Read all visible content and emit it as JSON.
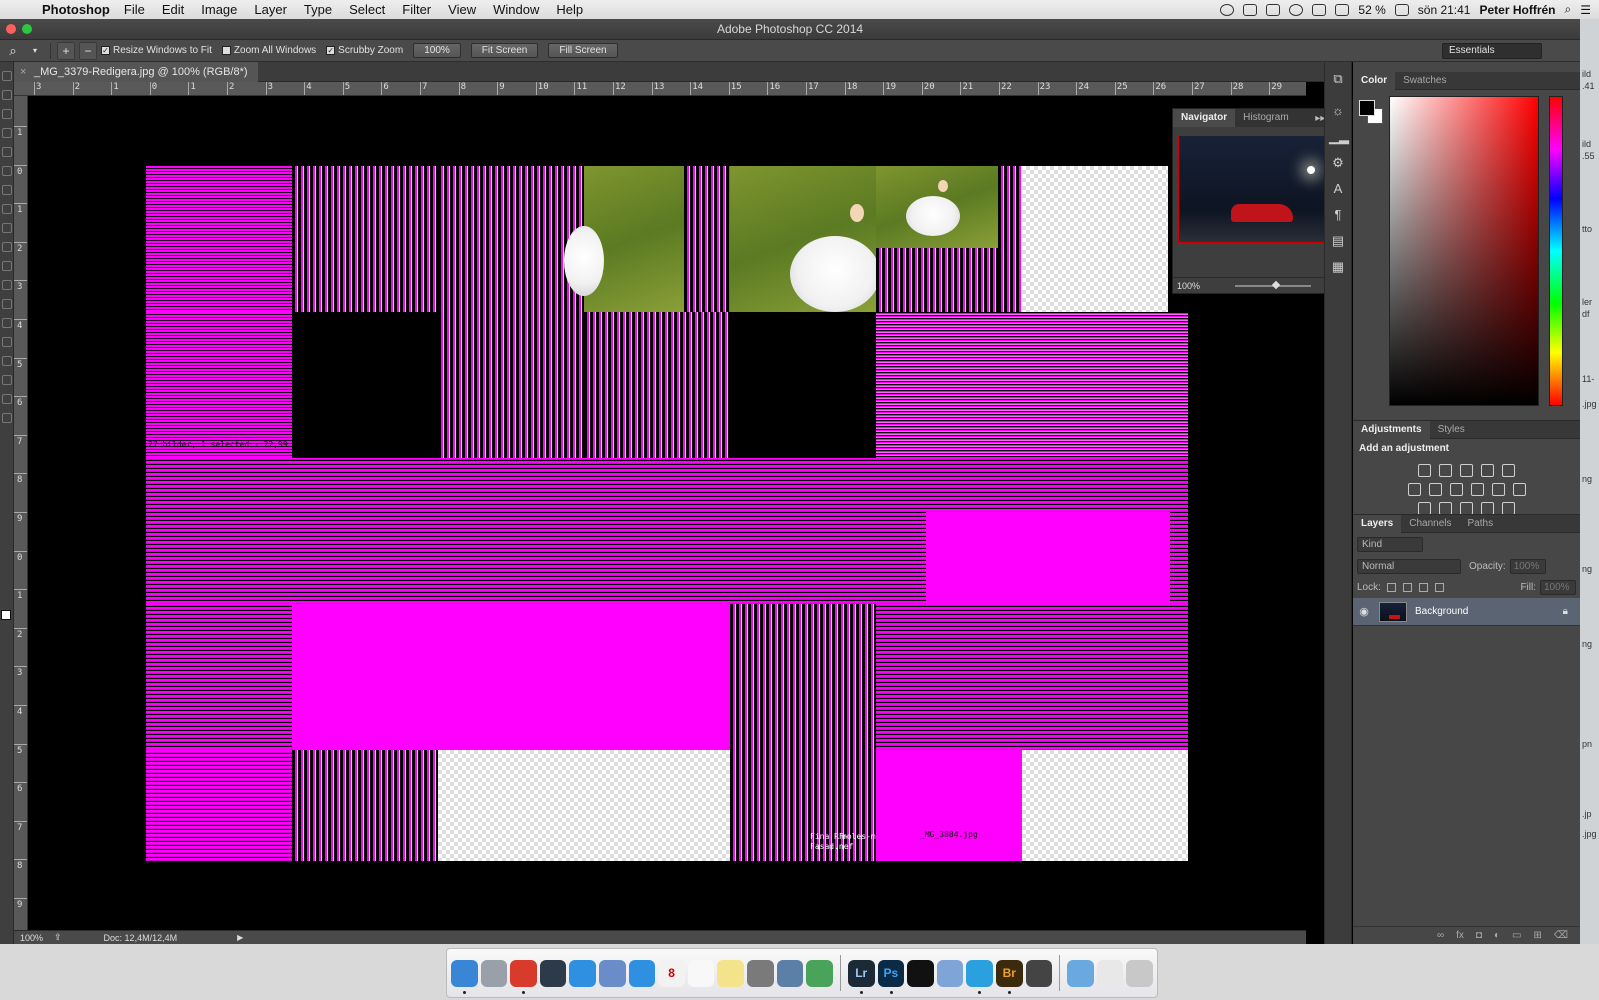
{
  "menubar": {
    "apple": "",
    "app_name": "Photoshop",
    "items": [
      "File",
      "Edit",
      "Image",
      "Layer",
      "Type",
      "Select",
      "Filter",
      "View",
      "Window",
      "Help"
    ],
    "battery": "52 %",
    "clock": "sön 21:41",
    "user": "Peter Hoffrén"
  },
  "window": {
    "title": "Adobe Photoshop CC 2014"
  },
  "options_bar": {
    "resize_windows_label": "Resize Windows to Fit",
    "zoom_all_label": "Zoom All Windows",
    "scrubby_zoom_label": "Scrubby Zoom",
    "zoom_100": "100%",
    "fit_screen": "Fit Screen",
    "fill_screen": "Fill Screen",
    "workspace": "Essentials"
  },
  "document": {
    "tab_title": "_MG_3379-Redigera.jpg @ 100% (RGB/8*)",
    "close": "×"
  },
  "rulers": {
    "top_labels": [
      "3",
      "2",
      "1",
      "0",
      "1",
      "2",
      "3",
      "4",
      "5",
      "6",
      "7",
      "8",
      "9",
      "10",
      "11",
      "12",
      "13",
      "14",
      "15",
      "16",
      "17",
      "18",
      "19",
      "20",
      "21",
      "22",
      "23",
      "24",
      "25",
      "26",
      "27",
      "28",
      "29"
    ],
    "left_labels": [
      "1",
      "0",
      "1",
      "2",
      "3",
      "4",
      "5",
      "6",
      "7",
      "8",
      "9",
      "0",
      "1",
      "2",
      "3",
      "4",
      "5",
      "6",
      "7",
      "8",
      "9"
    ]
  },
  "canvas_text": {
    "bridge_status": "27 bilder, 1 selected - 22,99 MB",
    "filename_1": "_MG_3884.jpg",
    "folder_1": "Fasad.nef",
    "folder_2": "Fina RF-",
    "folder_3": "moles-mall"
  },
  "navigator": {
    "tabs": [
      "Navigator",
      "Histogram"
    ],
    "zoom": "100%"
  },
  "color_panel": {
    "tabs": [
      "Color",
      "Swatches"
    ],
    "fg_color": "#000000",
    "bg_color": "#ffffff"
  },
  "adjustments_panel": {
    "tabs": [
      "Adjustments",
      "Styles"
    ],
    "heading": "Add an adjustment",
    "icons_row1": [
      "brightness-contrast-icon",
      "levels-icon",
      "curves-icon",
      "exposure-icon",
      "vibrance-icon"
    ],
    "icons_row2": [
      "hue-saturation-icon",
      "color-balance-icon",
      "black-white-icon",
      "photo-filter-icon",
      "channel-mixer-icon",
      "color-lookup-icon"
    ],
    "icons_row3": [
      "invert-icon",
      "posterize-icon",
      "threshold-icon",
      "selective-color-icon",
      "gradient-map-icon"
    ]
  },
  "layers_panel": {
    "tabs": [
      "Layers",
      "Channels",
      "Paths"
    ],
    "filter_kind": "Kind",
    "blend_mode": "Normal",
    "opacity_label": "Opacity:",
    "opacity_value": "100%",
    "lock_label": "Lock:",
    "fill_label": "Fill:",
    "fill_value": "100%",
    "layers": [
      {
        "name": "Background",
        "visible": true,
        "locked": true
      }
    ]
  },
  "status_bar": {
    "zoom": "100%",
    "doc_info": "Doc: 12,4M/12,4M"
  },
  "right_edge_text": [
    "ild",
    ".41",
    "ild",
    ".55",
    "tto",
    "ler",
    "df",
    "11-",
    ".jpg",
    "ng",
    "ng",
    "ng",
    "pn",
    ".jp",
    ".jpg"
  ],
  "dock": {
    "apps": [
      {
        "name": "finder-icon",
        "label": "",
        "color": "#3a86d6",
        "running": true
      },
      {
        "name": "launchpad-icon",
        "label": "",
        "color": "#9aa0aa",
        "running": false
      },
      {
        "name": "chrome-icon",
        "label": "",
        "color": "#d83b2b",
        "running": true
      },
      {
        "name": "mission-control-icon",
        "label": "",
        "color": "#2d3a4a",
        "running": false
      },
      {
        "name": "app-store-icon",
        "label": "",
        "color": "#2f8fe0",
        "running": false
      },
      {
        "name": "mail-send-icon",
        "label": "",
        "color": "#6a8cc8",
        "running": false
      },
      {
        "name": "safari-icon",
        "label": "",
        "color": "#2f8fe0",
        "running": false
      },
      {
        "name": "calendar-icon",
        "label": "8",
        "color": "#f2f2f2",
        "running": false
      },
      {
        "name": "reminders-icon",
        "label": "",
        "color": "#f8f8f8",
        "running": false
      },
      {
        "name": "notes-icon",
        "label": "",
        "color": "#f3e38a",
        "running": false
      },
      {
        "name": "system-preferences-icon",
        "label": "",
        "color": "#7a7a7a",
        "running": false
      },
      {
        "name": "preview-icon",
        "label": "",
        "color": "#5c7fa8",
        "running": false
      },
      {
        "name": "spotify-icon",
        "label": "",
        "color": "#4aa35a",
        "running": false
      },
      {
        "name": "lightroom-icon",
        "label": "Lr",
        "color": "#1c2a38",
        "running": true
      },
      {
        "name": "photoshop-icon",
        "label": "Ps",
        "color": "#0b2a45",
        "running": true
      },
      {
        "name": "terminal-icon",
        "label": "",
        "color": "#111111",
        "running": false
      },
      {
        "name": "mail-icon",
        "label": "",
        "color": "#7fa4d8",
        "running": false
      },
      {
        "name": "skype-icon",
        "label": "",
        "color": "#2aa0df",
        "running": true
      },
      {
        "name": "bridge-icon",
        "label": "Br",
        "color": "#3b2a0c",
        "running": true
      },
      {
        "name": "disk-utility-icon",
        "label": "",
        "color": "#444444",
        "running": false
      },
      {
        "name": "applications-folder-icon",
        "label": "",
        "color": "#6aa8e0",
        "running": false
      },
      {
        "name": "documents-icon",
        "label": "",
        "color": "#e8e8e8",
        "running": false
      },
      {
        "name": "trash-icon",
        "label": "",
        "color": "#c8c8c8",
        "running": false
      }
    ]
  }
}
